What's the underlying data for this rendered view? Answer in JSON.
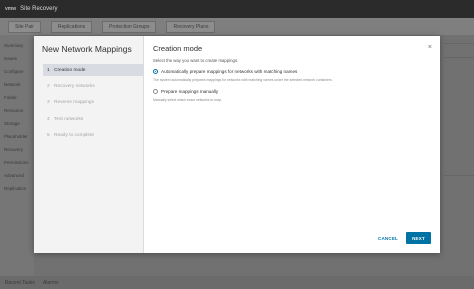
{
  "background": {
    "header": {
      "logo": "vmw",
      "title": "Site Recovery",
      "subtitle": ""
    },
    "tabs": [
      "Site Pair",
      "Replications",
      "Protection Groups",
      "Recovery Plans"
    ],
    "sidebar_items": [
      "Summary",
      "Issues",
      "Configure",
      "Network",
      "Folder",
      "Resource",
      "Storage",
      "Placeholder",
      "Recovery",
      "Permissions",
      "Advanced",
      "Replication"
    ],
    "bottom": [
      "Recent Tasks",
      "Alarms"
    ]
  },
  "modal": {
    "title": "New Network Mappings",
    "steps": [
      {
        "num": "1",
        "label": "Creation mode"
      },
      {
        "num": "2",
        "label": "Recovery networks"
      },
      {
        "num": "3",
        "label": "Reverse mappings"
      },
      {
        "num": "4",
        "label": "Test networks"
      },
      {
        "num": "5",
        "label": "Ready to complete"
      }
    ],
    "content_title": "Creation mode",
    "instruction": "Select the way you want to create mappings.",
    "options": [
      {
        "label": "Automatically prepare mappings for networks with matching names",
        "description": "The system automatically prepares mappings for networks with matching names under the selected network containers.",
        "selected": true
      },
      {
        "label": "Prepare mappings manually",
        "description": "Manually select which exact networks to map.",
        "selected": false
      }
    ],
    "close_icon": "×",
    "cancel_label": "CANCEL",
    "next_label": "NEXT"
  },
  "colors": {
    "accent": "#0072a3",
    "sidebar_bg": "#f3f3f3",
    "active_step_bg": "#d8dce2"
  }
}
